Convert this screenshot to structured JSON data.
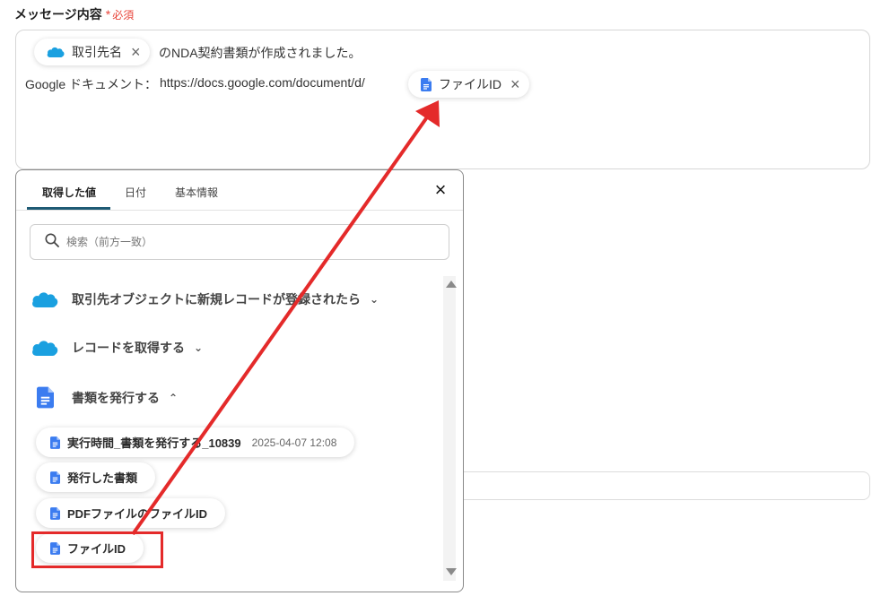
{
  "field": {
    "label": "メッセージ内容",
    "required_mark": "*",
    "required_text": "必須"
  },
  "message": {
    "chip_account": "取引先名",
    "line1_text": "のNDA契約書類が作成されました。",
    "line2_prefix": "Google ドキュメント：",
    "line2_url": "https://docs.google.com/document/d/",
    "chip_file": "ファイルID"
  },
  "panel": {
    "tabs": [
      "取得した値",
      "日付",
      "基本情報"
    ],
    "close_icon": "×",
    "search_placeholder": "検索（前方一致）",
    "sections": [
      {
        "label": "取引先オブジェクトに新規レコードが登録されたら",
        "icon": "salesforce-cloud-icon",
        "chevron": "⌄"
      },
      {
        "label": "レコードを取得する",
        "icon": "salesforce-cloud-icon",
        "chevron": "⌄"
      },
      {
        "label": "書類を発行する",
        "icon": "google-docs-icon",
        "chevron": "⌃"
      }
    ],
    "items": [
      {
        "label": "実行時間_書類を発行する_10839",
        "timestamp": "2025-04-07 12:08"
      },
      {
        "label": "発行した書類",
        "timestamp": ""
      },
      {
        "label": "PDFファイルのファイルID",
        "timestamp": ""
      },
      {
        "label": "ファイルID",
        "timestamp": ""
      }
    ]
  },
  "colors": {
    "salesforce": "#1aa0e0",
    "google_docs": "#3b7cf0",
    "annotation_red": "#e42a2a",
    "tab_active": "#1e5a74"
  }
}
